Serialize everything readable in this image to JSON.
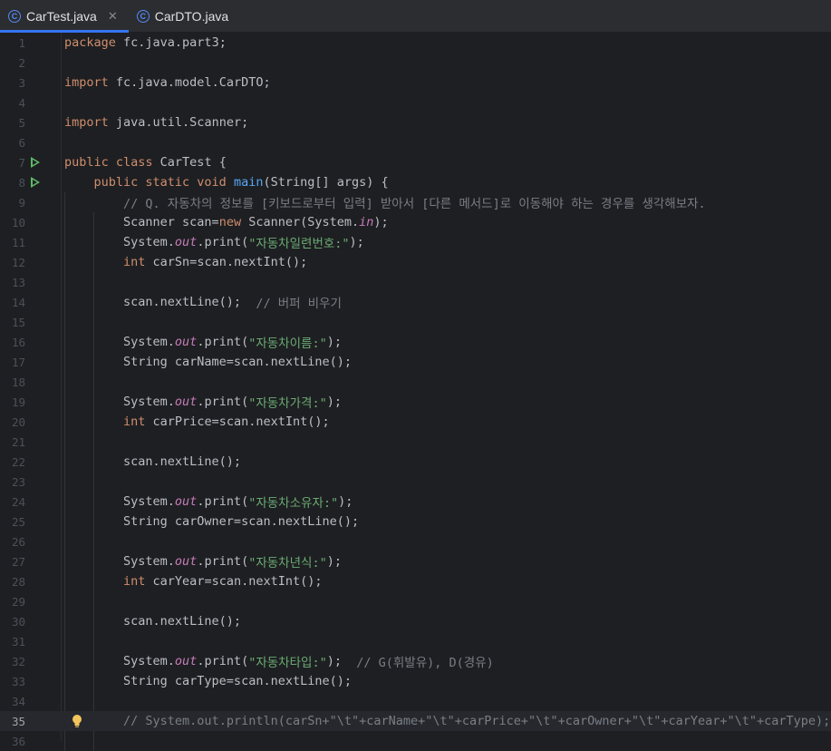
{
  "tabs": [
    {
      "label": "CarTest.java",
      "icon": "class-icon",
      "active": true,
      "closable": true
    },
    {
      "label": "CarDTO.java",
      "icon": "class-icon",
      "active": false,
      "closable": false
    }
  ],
  "editor": {
    "current_line": 35,
    "lines": [
      {
        "n": "1",
        "code": [
          [
            "kw",
            "package "
          ],
          [
            "tx",
            "fc.java.part3;"
          ]
        ]
      },
      {
        "n": "2",
        "code": []
      },
      {
        "n": "3",
        "code": [
          [
            "kw",
            "import "
          ],
          [
            "tx",
            "fc.java.model.CarDTO;"
          ]
        ]
      },
      {
        "n": "4",
        "code": []
      },
      {
        "n": "5",
        "code": [
          [
            "kw",
            "import "
          ],
          [
            "tx",
            "java.util.Scanner;"
          ]
        ]
      },
      {
        "n": "6",
        "code": []
      },
      {
        "n": "7",
        "code": [
          [
            "kw",
            "public class "
          ],
          [
            "tx",
            "CarTest {"
          ]
        ],
        "run": true
      },
      {
        "n": "8",
        "code": [
          [
            "tx",
            "    "
          ],
          [
            "kw",
            "public static void "
          ],
          [
            "fn",
            "main"
          ],
          [
            "tx",
            "(String[] args) {"
          ]
        ],
        "run": true
      },
      {
        "n": "9",
        "code": [
          [
            "tx",
            "        "
          ],
          [
            "cm",
            "// Q. 자동차의 정보를 [키보드로부터 입력] 받아서 [다른 메서드]로 이동해야 하는 경우를 생각해보자."
          ]
        ]
      },
      {
        "n": "10",
        "code": [
          [
            "tx",
            "        Scanner scan="
          ],
          [
            "kw",
            "new "
          ],
          [
            "tx",
            "Scanner(System."
          ],
          [
            "fld",
            "in"
          ],
          [
            "tx",
            ");"
          ]
        ]
      },
      {
        "n": "11",
        "code": [
          [
            "tx",
            "        System."
          ],
          [
            "fld",
            "out"
          ],
          [
            "tx",
            ".print("
          ],
          [
            "str",
            "\"자동차일련번호:\""
          ],
          [
            "tx",
            ");"
          ]
        ]
      },
      {
        "n": "12",
        "code": [
          [
            "tx",
            "        "
          ],
          [
            "kw",
            "int "
          ],
          [
            "tx",
            "carSn=scan.nextInt();"
          ]
        ]
      },
      {
        "n": "13",
        "code": []
      },
      {
        "n": "14",
        "code": [
          [
            "tx",
            "        scan.nextLine();  "
          ],
          [
            "cm",
            "// 버퍼 비우기"
          ]
        ]
      },
      {
        "n": "15",
        "code": []
      },
      {
        "n": "16",
        "code": [
          [
            "tx",
            "        System."
          ],
          [
            "fld",
            "out"
          ],
          [
            "tx",
            ".print("
          ],
          [
            "str",
            "\"자동차이름:\""
          ],
          [
            "tx",
            ");"
          ]
        ]
      },
      {
        "n": "17",
        "code": [
          [
            "tx",
            "        String carName=scan.nextLine();"
          ]
        ]
      },
      {
        "n": "18",
        "code": []
      },
      {
        "n": "19",
        "code": [
          [
            "tx",
            "        System."
          ],
          [
            "fld",
            "out"
          ],
          [
            "tx",
            ".print("
          ],
          [
            "str",
            "\"자동차가격:\""
          ],
          [
            "tx",
            ");"
          ]
        ]
      },
      {
        "n": "20",
        "code": [
          [
            "tx",
            "        "
          ],
          [
            "kw",
            "int "
          ],
          [
            "tx",
            "carPrice=scan.nextInt();"
          ]
        ]
      },
      {
        "n": "21",
        "code": []
      },
      {
        "n": "22",
        "code": [
          [
            "tx",
            "        scan.nextLine();"
          ]
        ]
      },
      {
        "n": "23",
        "code": []
      },
      {
        "n": "24",
        "code": [
          [
            "tx",
            "        System."
          ],
          [
            "fld",
            "out"
          ],
          [
            "tx",
            ".print("
          ],
          [
            "str",
            "\"자동차소유자:\""
          ],
          [
            "tx",
            ");"
          ]
        ]
      },
      {
        "n": "25",
        "code": [
          [
            "tx",
            "        String carOwner=scan.nextLine();"
          ]
        ]
      },
      {
        "n": "26",
        "code": []
      },
      {
        "n": "27",
        "code": [
          [
            "tx",
            "        System."
          ],
          [
            "fld",
            "out"
          ],
          [
            "tx",
            ".print("
          ],
          [
            "str",
            "\"자동차년식:\""
          ],
          [
            "tx",
            ");"
          ]
        ]
      },
      {
        "n": "28",
        "code": [
          [
            "tx",
            "        "
          ],
          [
            "kw",
            "int "
          ],
          [
            "tx",
            "carYear=scan.nextInt();"
          ]
        ]
      },
      {
        "n": "29",
        "code": []
      },
      {
        "n": "30",
        "code": [
          [
            "tx",
            "        scan.nextLine();"
          ]
        ]
      },
      {
        "n": "31",
        "code": []
      },
      {
        "n": "32",
        "code": [
          [
            "tx",
            "        System."
          ],
          [
            "fld",
            "out"
          ],
          [
            "tx",
            ".print("
          ],
          [
            "str",
            "\"자동차타입:\""
          ],
          [
            "tx",
            ");  "
          ],
          [
            "cm",
            "// G(휘발유), D(경유)"
          ]
        ]
      },
      {
        "n": "33",
        "code": [
          [
            "tx",
            "        String carType=scan.nextLine();"
          ]
        ]
      },
      {
        "n": "34",
        "code": []
      },
      {
        "n": "35",
        "code": [
          [
            "tx",
            "        "
          ],
          [
            "cm",
            "// System.out.println(carSn+\"\\t\"+carName+\"\\t\"+carPrice+\"\\t\"+carOwner+\"\\t\"+carYear+\"\\t\"+carType);"
          ]
        ],
        "bulb": true
      },
      {
        "n": "36",
        "code": []
      }
    ]
  },
  "colors": {
    "keyword": "#cf8e6d",
    "function": "#56a8f5",
    "string": "#6aab73",
    "comment": "#7a7e85",
    "field": "#c77dbb",
    "accent": "#3574f0"
  }
}
